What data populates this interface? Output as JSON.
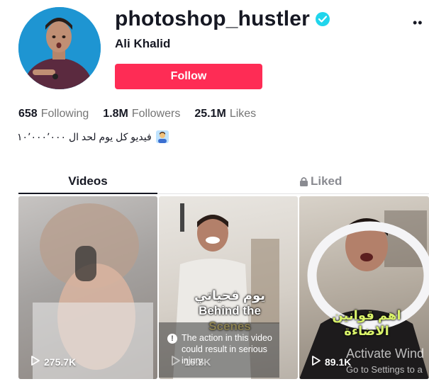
{
  "profile": {
    "username": "photoshop_hustler",
    "nickname": "Ali Khalid",
    "follow_label": "Follow",
    "more_label": "••"
  },
  "stats": [
    {
      "value": "658",
      "label": "Following"
    },
    {
      "value": "1.8M",
      "label": "Followers"
    },
    {
      "value": "25.1M",
      "label": "Likes"
    }
  ],
  "bio": {
    "text": "فيديو كل يوم لحد ال ١٠٬٠٠٠٬٠٠٠"
  },
  "tabs": {
    "videos": "Videos",
    "liked": "Liked"
  },
  "videos": [
    {
      "views": "275.7K"
    },
    {
      "views": "16.8K",
      "caption_ar": "يوم فحياتي",
      "caption_line1": "Behind the",
      "caption_line2": "Scenes",
      "warning": "The action in this video could result in serious injury."
    },
    {
      "views": "89.1K",
      "caption_ar_line1": "اهم قوانين",
      "caption_ar_line2": "الاضاءة"
    }
  ],
  "os_watermark": {
    "line1": "Activate Wind",
    "line2": "Go to Settings to a"
  },
  "colors": {
    "follow_button": "#fe2c55",
    "verified_badge": "#20d5ec",
    "text_primary": "#161823",
    "text_secondary": "#757575"
  }
}
